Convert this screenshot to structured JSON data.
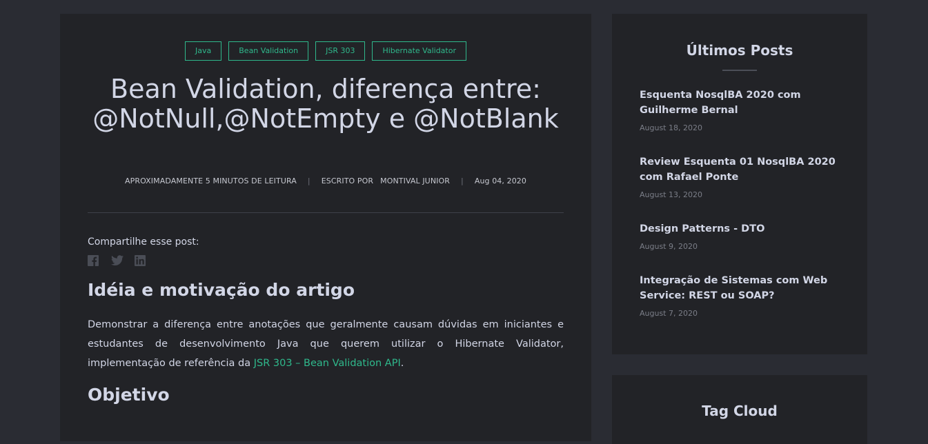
{
  "article": {
    "tags": [
      "Java",
      "Bean Validation",
      "JSR 303",
      "Hibernate Validator"
    ],
    "title": "Bean Validation, diferença entre: @NotNull,@NotEmpty e @NotBlank",
    "meta": {
      "reading_time": "APROXIMADAMENTE 5 MINUTOS DE LEITURA",
      "written_by_label": "ESCRITO POR",
      "author": "MONTIVAL JUNIOR",
      "date": "Aug 04, 2020",
      "separator": "|"
    },
    "share_label": "Compartilhe esse post:",
    "share_icons": [
      "facebook-icon",
      "twitter-icon",
      "linkedin-icon"
    ],
    "heading_1": "Idéia e motivação do artigo",
    "paragraph_1_text": "Demonstrar a diferença entre anotações que geralmente causam dúvidas em iniciantes e estudantes de desenvolvimento Java que querem utilizar o Hibernate Validator, implementação de referência da ",
    "paragraph_1_link": "JSR 303 – Bean Validation API",
    "paragraph_1_end": ".",
    "heading_2": "Objetivo"
  },
  "sidebar": {
    "latest_posts_title": "Últimos Posts",
    "posts": [
      {
        "title": "Esquenta NosqlBA 2020 com Guilherme Bernal",
        "date": "August 18, 2020"
      },
      {
        "title": "Review Esquenta 01 NosqlBA 2020 com Rafael Ponte",
        "date": "August 13, 2020"
      },
      {
        "title": "Design Patterns - DTO",
        "date": "August 9, 2020"
      },
      {
        "title": "Integração de Sistemas com Web Service: REST ou SOAP?",
        "date": "August 7, 2020"
      }
    ],
    "tag_cloud_title": "Tag Cloud"
  },
  "colors": {
    "background": "#2a2c33",
    "card": "#222327",
    "accent": "#2fb98c",
    "text": "#d2d6e6",
    "muted": "#7b7e88"
  }
}
